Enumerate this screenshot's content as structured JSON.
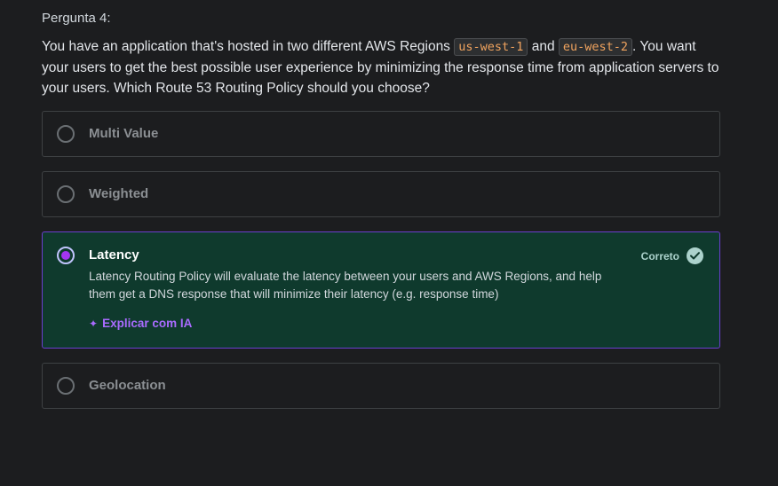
{
  "question": {
    "label": "Pergunta 4:",
    "text_part1": "You have an application that's hosted in two different AWS Regions ",
    "code1": "us-west-1",
    "text_part2": " and ",
    "code2": "eu-west-2",
    "text_part3": ". You want your users to get the best possible user experience by minimizing the response time from application servers to your users. Which Route 53 Routing Policy should you choose?"
  },
  "options": [
    {
      "label": "Multi Value"
    },
    {
      "label": "Weighted"
    },
    {
      "label": "Latency",
      "explanation": "Latency Routing Policy will evaluate the latency between your users and AWS Regions, and help them get a DNS response that will minimize their latency (e.g. response time)",
      "status": "Correto",
      "ai_button": "Explicar com IA"
    },
    {
      "label": "Geolocation"
    }
  ],
  "colors": {
    "background": "#1c1d1f",
    "correct_bg": "#0f3a2d",
    "selected_border": "#6a3fd0",
    "accent_purple": "#a96bff",
    "correct_green": "#acd2cc",
    "code_text": "#f0a35e"
  },
  "icons": [
    "radio-empty-icon",
    "radio-selected-icon",
    "check-circle-icon",
    "sparkle-icon"
  ]
}
